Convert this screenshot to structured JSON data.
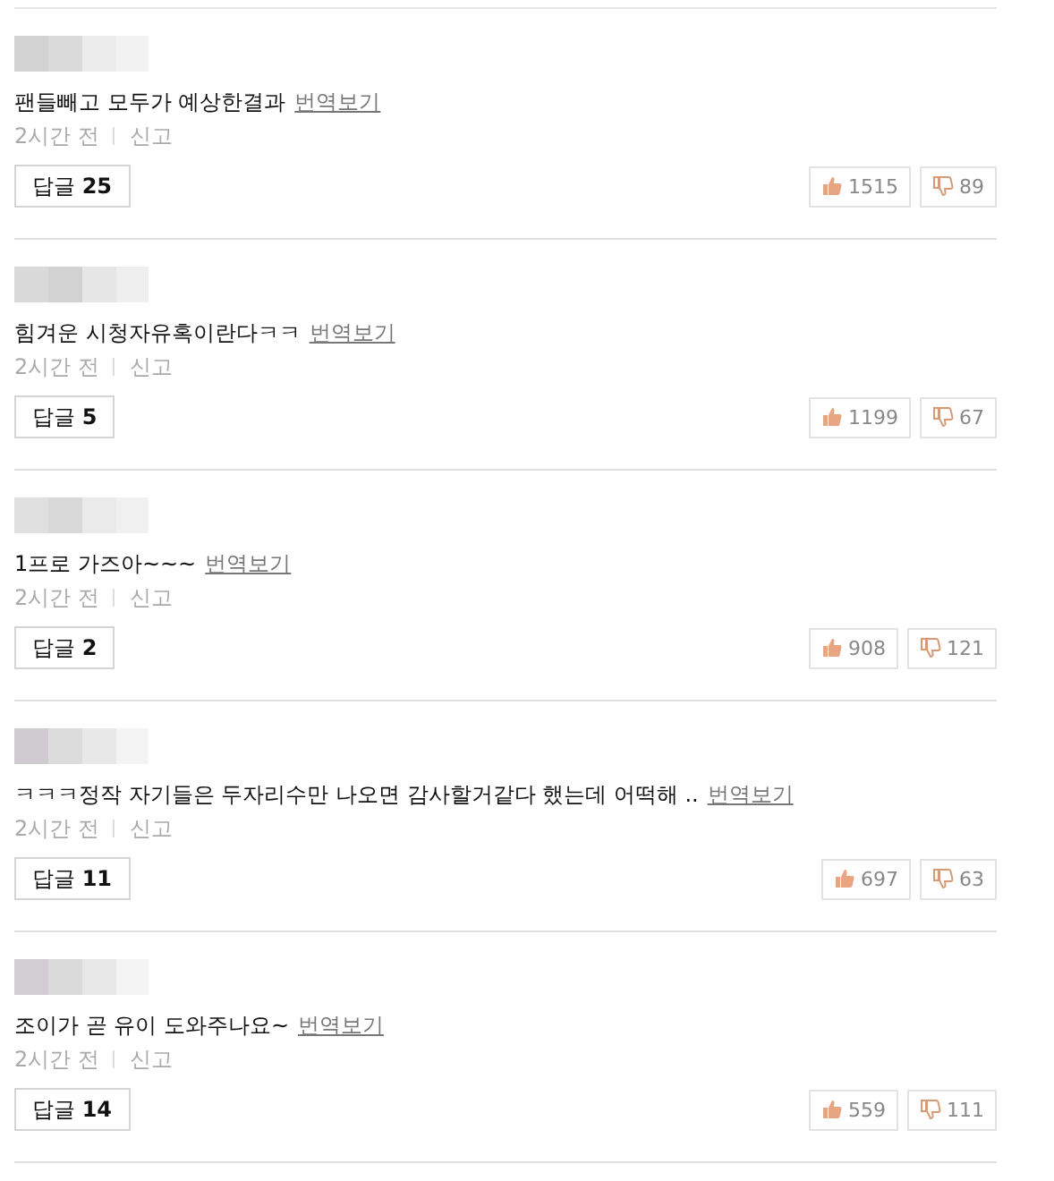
{
  "comments": [
    {
      "text": "팬들빼고 모두가 예상한결과",
      "translate": "번역보기",
      "time": "2시간 전",
      "report": "신고",
      "replies": "답글 **25**",
      "likes": "1515",
      "dislikes": "89"
    },
    {
      "text": "힘겨운 시청자유혹이란다ㅋㅋ",
      "translate": "번역보기",
      "time": "2시간 전",
      "report": "신고",
      "replies": "답글 **5**",
      "likes": "1199",
      "dislikes": "67"
    },
    {
      "text": "1프로 가즈아~~~",
      "translate": "번역보기",
      "time": "2시간 전",
      "report": "신고",
      "replies": "답글 **2**",
      "likes": "908",
      "dislikes": "121"
    },
    {
      "text": "ㅋㅋㅋ정작 자기들은 두자리수만 나오면 감사할거같다 했는데 어떡해 ..",
      "translate": "번역보기",
      "time": "2시간 전",
      "report": "신고",
      "replies": "답글 **11**",
      "likes": "697",
      "dislikes": "63"
    },
    {
      "text": "조이가 곧 유이 도와주나요~",
      "translate": "번역보기",
      "time": "2시간 전",
      "report": "신고",
      "replies": "답글 **14**",
      "likes": "559",
      "dislikes": "111"
    }
  ]
}
